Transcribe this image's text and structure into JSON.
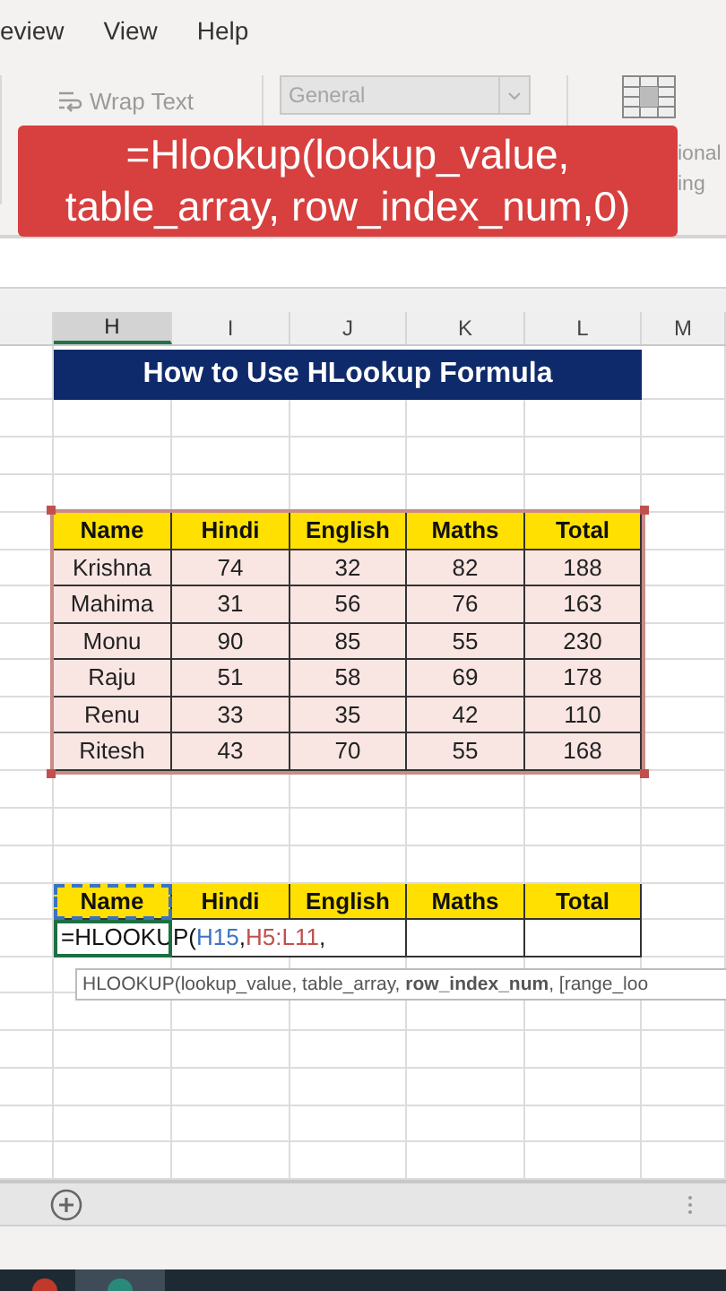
{
  "ribbon": {
    "menu_tabs": [
      {
        "label": "eview"
      },
      {
        "label": "View"
      },
      {
        "label": "Help"
      }
    ],
    "wrap_text": {
      "label": "Wrap Text",
      "disabled": true
    },
    "number_format": {
      "value": "General",
      "disabled": true
    },
    "cut_labels": [
      "ional",
      "ing"
    ]
  },
  "banner": {
    "text": "=Hlookup(lookup_value, table_array, row_index_num,0)"
  },
  "column_headers": [
    {
      "label": "H",
      "selected": true
    },
    {
      "label": "I",
      "selected": false
    },
    {
      "label": "J",
      "selected": false
    },
    {
      "label": "K",
      "selected": false
    },
    {
      "label": "L",
      "selected": false
    },
    {
      "label": "M",
      "selected": false
    }
  ],
  "title": "How to Use HLookup Formula",
  "data_table": {
    "columns": [
      "Name",
      "Hindi",
      "English",
      "Maths",
      "Total"
    ],
    "rows": [
      [
        "Krishna",
        "74",
        "32",
        "82",
        "188"
      ],
      [
        "Mahima",
        "31",
        "56",
        "76",
        "163"
      ],
      [
        "Monu",
        "90",
        "85",
        "55",
        "230"
      ],
      [
        "Raju",
        "51",
        "58",
        "69",
        "178"
      ],
      [
        "Renu",
        "33",
        "35",
        "42",
        "110"
      ],
      [
        "Ritesh",
        "43",
        "70",
        "55",
        "168"
      ]
    ]
  },
  "lookup_table": {
    "columns": [
      "Name",
      "Hindi",
      "English",
      "Maths",
      "Total"
    ],
    "formula_parts": [
      {
        "text": "=HLOOKUP(",
        "kind": "plain"
      },
      {
        "text": "H15",
        "kind": "ref",
        "color": "#3b73c2"
      },
      {
        "text": ",",
        "kind": "plain"
      },
      {
        "text": "H5:L11",
        "kind": "ref",
        "color": "#c0504d"
      },
      {
        "text": ",",
        "kind": "plain"
      }
    ]
  },
  "tooltip": "HLOOKUP(lookup_value, table_array, **row_index_num**, [range_loo"
}
